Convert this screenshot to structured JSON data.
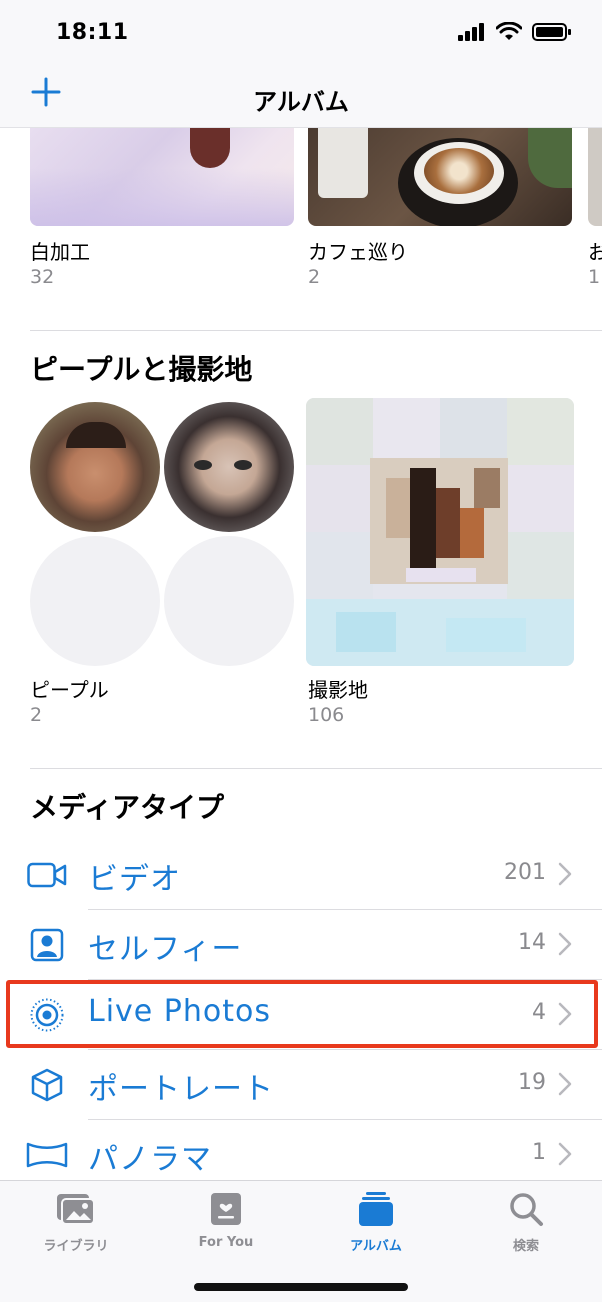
{
  "status": {
    "time": "18:11"
  },
  "nav": {
    "title": "アルバム"
  },
  "albums": [
    {
      "name": "白加工",
      "count": "32"
    },
    {
      "name": "カフェ巡り",
      "count": "2"
    },
    {
      "name": "お",
      "count": "1"
    }
  ],
  "people_places": {
    "title": "ピープルと撮影地",
    "people": {
      "label": "ピープル",
      "count": "2"
    },
    "places": {
      "label": "撮影地",
      "count": "106"
    }
  },
  "media_types": {
    "title": "メディアタイプ",
    "items": [
      {
        "label": "ビデオ",
        "count": "201",
        "icon": "video-icon"
      },
      {
        "label": "セルフィー",
        "count": "14",
        "icon": "selfie-icon"
      },
      {
        "label": "Live Photos",
        "count": "4",
        "icon": "live-photo-icon"
      },
      {
        "label": "ポートレート",
        "count": "19",
        "icon": "portrait-cube-icon"
      },
      {
        "label": "パノラマ",
        "count": "1",
        "icon": "panorama-icon"
      }
    ]
  },
  "tabs": [
    {
      "label": "ライブラリ",
      "icon": "library-icon",
      "active": false
    },
    {
      "label": "For You",
      "icon": "for-you-icon",
      "active": false
    },
    {
      "label": "アルバム",
      "icon": "albums-icon",
      "active": true
    },
    {
      "label": "検索",
      "icon": "search-icon",
      "active": false
    }
  ],
  "colors": {
    "accent": "#1a7bd4",
    "highlight": "#e8391d",
    "secondary_text": "#8a8a8e"
  }
}
